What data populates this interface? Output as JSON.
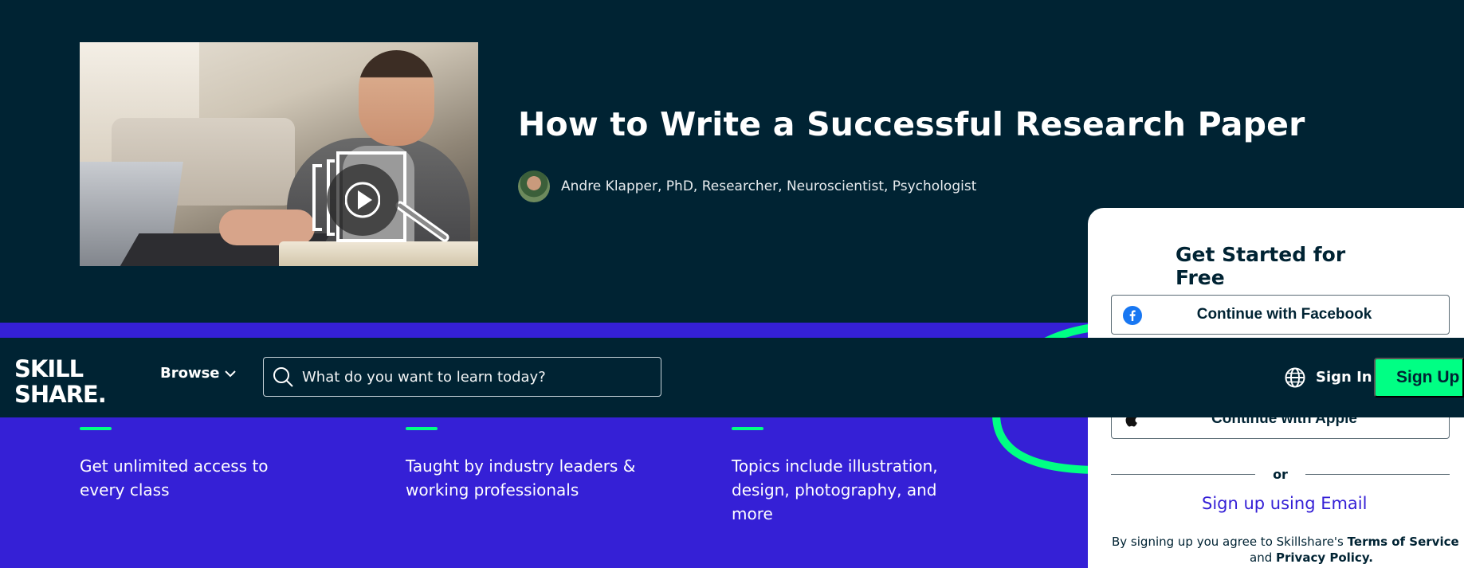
{
  "hero": {
    "title": "How to Write a Successful Research Paper",
    "author": "Andre Klapper, PhD, Researcher, Neuroscientist, Psychologist"
  },
  "nav": {
    "logo_line1": "SKILL",
    "logo_line2": "SHARE.",
    "browse_label": "Browse",
    "search_placeholder": "What do you want to learn today?",
    "signin_label": "Sign In",
    "signup_label": "Sign Up"
  },
  "features": [
    {
      "text": "Get unlimited access to every class"
    },
    {
      "text": "Taught by industry leaders & working professionals"
    },
    {
      "text": "Topics include illustration, design, photography, and more"
    }
  ],
  "signup_card": {
    "title": "Get Started for Free",
    "facebook_label": "Continue with Facebook",
    "apple_label": "Continue with Apple",
    "or_label": "or",
    "email_label": "Sign up using Email",
    "terms_prefix": "By signing up you agree to Skillshare's",
    "terms_link": "Terms of Service",
    "terms_and": "and",
    "privacy_link": "Privacy Policy."
  },
  "colors": {
    "navy": "#002333",
    "purple": "#3520d6",
    "green": "#00ff84",
    "facebook_blue": "#1877f2"
  },
  "icons": {
    "search": "search-icon",
    "globe": "globe-icon",
    "chevron": "chevron-down-icon",
    "play": "play-icon",
    "facebook": "facebook-icon",
    "apple": "apple-icon"
  }
}
